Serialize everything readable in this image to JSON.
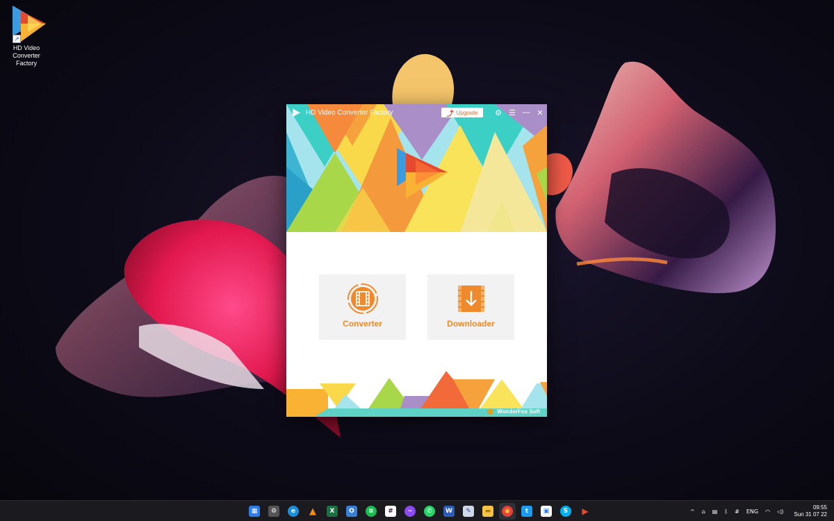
{
  "desktop": {
    "icon_label": "HD Video Converter Factory"
  },
  "window": {
    "title": "HD Video Converter Factory",
    "upgrade_label": "Upgrade",
    "tiles": [
      {
        "label": "Converter",
        "icon": "film-icon"
      },
      {
        "label": "Downloader",
        "icon": "download-icon"
      }
    ],
    "brand": "WonderFox Soft"
  },
  "colors": {
    "accent_orange": "#ef8a2c",
    "teal": "#3ccfc6",
    "yellow": "#f9d94a",
    "purple": "#a98ec7",
    "red": "#e64a2e"
  },
  "taskbar": {
    "apps": [
      {
        "name": "start",
        "glyph": "▦"
      },
      {
        "name": "settings",
        "glyph": "⚙"
      },
      {
        "name": "edge",
        "glyph": "e"
      },
      {
        "name": "vlc",
        "glyph": "▲"
      },
      {
        "name": "excel",
        "glyph": "X"
      },
      {
        "name": "office",
        "glyph": "O"
      },
      {
        "name": "spotify",
        "glyph": "≡"
      },
      {
        "name": "slack",
        "glyph": "#"
      },
      {
        "name": "messenger",
        "glyph": "~"
      },
      {
        "name": "whatsapp",
        "glyph": "✆"
      },
      {
        "name": "word",
        "glyph": "W"
      },
      {
        "name": "editor",
        "glyph": "✎"
      },
      {
        "name": "file-explorer",
        "glyph": "▬"
      },
      {
        "name": "chrome",
        "glyph": "◉"
      },
      {
        "name": "twitter",
        "glyph": "t"
      },
      {
        "name": "store",
        "glyph": "▣"
      },
      {
        "name": "skype",
        "glyph": "S"
      },
      {
        "name": "hd-video-converter",
        "glyph": "▶"
      }
    ],
    "tray": {
      "language": "ENG",
      "time": "09:55",
      "date": "Sun 31 07 22"
    }
  }
}
